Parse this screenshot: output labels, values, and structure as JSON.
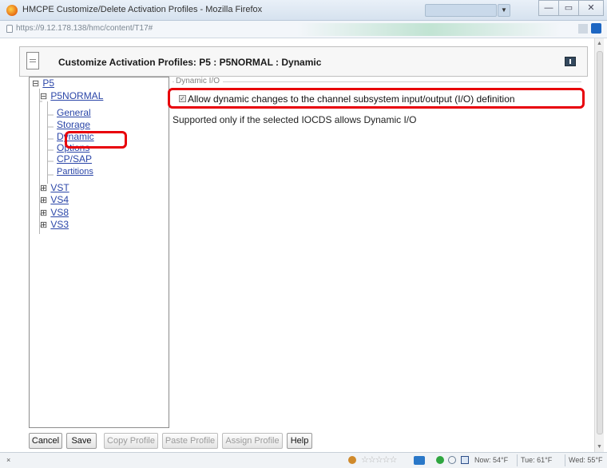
{
  "browser": {
    "window_title": "HMCPE Customize/Delete Activation Profiles - Mozilla Firefox",
    "search_placeholder": "",
    "url": "https://9.12.178.138/hmc/content/T17#",
    "window_buttons": {
      "minimize": "—",
      "maximize": "▭",
      "close": "✕"
    }
  },
  "page": {
    "title": "Customize Activation Profiles: P5 : P5NORMAL : Dynamic"
  },
  "tree": {
    "root": {
      "label": "P5",
      "expander": "⊟"
    },
    "profile": {
      "label": "P5NORMAL",
      "expander": "⊟"
    },
    "pages": [
      {
        "label": "General"
      },
      {
        "label": "Storage"
      },
      {
        "label": "Dynamic"
      },
      {
        "label": "Options"
      },
      {
        "label": "CP/SAP"
      },
      {
        "label": "Partitions"
      }
    ],
    "others": [
      {
        "label": "VST",
        "expander": "⊞"
      },
      {
        "label": "VS4",
        "expander": "⊞"
      },
      {
        "label": "VS8",
        "expander": "⊞"
      },
      {
        "label": "VS3",
        "expander": "⊞"
      }
    ]
  },
  "content": {
    "section_legend": "Dynamic I/O",
    "checkbox_checked": true,
    "checkbox_mark": "✓",
    "checkbox_label": "Allow dynamic changes to the channel subsystem input/output (I/O) definition",
    "note": "Supported only if the selected IOCDS allows Dynamic I/O"
  },
  "buttons": [
    {
      "label": "Cancel",
      "enabled": true
    },
    {
      "label": "Save",
      "enabled": true
    },
    {
      "label": "Copy Profile",
      "enabled": false
    },
    {
      "label": "Paste Profile",
      "enabled": false
    },
    {
      "label": "Assign Profile",
      "enabled": false
    },
    {
      "label": "Help",
      "enabled": true
    }
  ],
  "statusbar": {
    "close_glyph": "×",
    "rating_stars": "☆☆☆☆☆",
    "weather_now": "Now: 54°F",
    "weather_tue": "Tue: 61°F",
    "weather_wed": "Wed: 55°F"
  },
  "colors": {
    "highlight": "#e8000a",
    "link": "#2b46a8"
  }
}
